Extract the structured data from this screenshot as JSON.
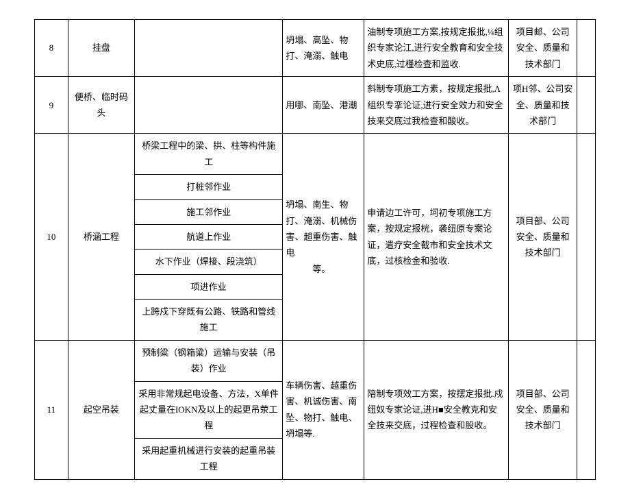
{
  "rows": [
    {
      "num": "8",
      "name": "挂盘",
      "sub": "",
      "risk": "坍塌、高坠、物打、淹溺、触电",
      "measure": "油制专项施工方案,按规定报批,¼组织专家论江,进行安全教育和安全技术史底,过槿检查和监收.",
      "dept": "项目邮、公司安全、质量和技术部门"
    },
    {
      "num": "9",
      "name": "便桥、临时码头",
      "sub": "",
      "risk": "用哪、南坠、港潮",
      "measure": "斜制专项施工方素，按规定报批,Λ组织专挛论证,进行安全效力和安全技来交底过我检查和酸收。",
      "dept": "项H邻、公司安全、质量和技术部门"
    },
    {
      "num": "10",
      "name": "桥涵工程",
      "subs": [
        "桥梁工程中的梁、拱、柱等构件施工",
        "打桩邻作业",
        "施工邻作业",
        "航道上作业",
        "水下作业（焊接、段浇筑）",
        "项进作业",
        "上跨戍下穿既有公路、铁路和管线施工"
      ],
      "risk": "坍塌、南生、物打、淹溺、机械伤害、趄重伤害、触电\n　　　等。",
      "measure": "申请边工许可，坷初专项施工方案，按规定报桄，袭纽原专案论证，遣疗安全截市和安全技术文底，过核检金和验收.",
      "dept": "项目部、公司安全、质量和技术部门"
    },
    {
      "num": "11",
      "name": "起空吊装",
      "subs": [
        "预制粱（钢箱粱）运输与安装（吊装）作业",
        "采用非常规起电设备、方法，X单件起丈量在IOKN及以上的起更吊荥工程",
        "采用起重机械进行安装的起重吊装工程"
      ],
      "risk": "车辆伤害、越重伤害、机诚伤害、南坠、物打、触电、坍塌等.",
      "measure": "陪制专项效工方案，按摆定报批.戍纽奴专家论证,进H■安全教克和安全技来交底，过程检查和股收。",
      "dept": "项目部、公司安全、质量和技术部门"
    }
  ]
}
